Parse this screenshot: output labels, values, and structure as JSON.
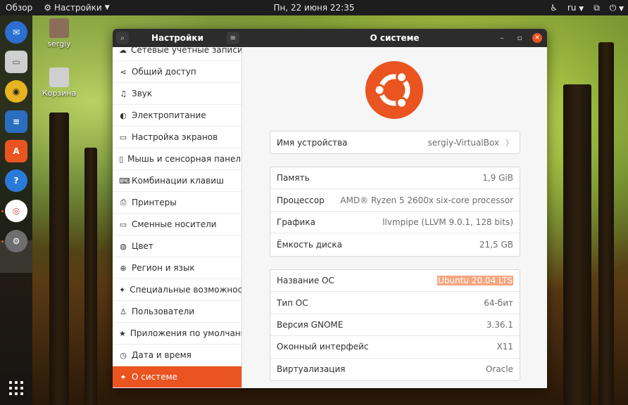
{
  "topbar": {
    "overview": "Обзор",
    "app_name": "Настройки",
    "clock": "Пн, 22 июня  22:35",
    "lang": "ru"
  },
  "desktop": {
    "home_label": "sergiy",
    "trash_label": "Корзина"
  },
  "window": {
    "sidebar_title": "Настройки",
    "main_title": "О системе"
  },
  "sidebar": {
    "items": [
      {
        "label": "Сетевые учётные записи",
        "icon": "cloud-icon"
      },
      {
        "label": "Общий доступ",
        "icon": "share-icon"
      },
      {
        "label": "Звук",
        "icon": "music-note-icon"
      },
      {
        "label": "Электропитание",
        "icon": "power-icon"
      },
      {
        "label": "Настройка экранов",
        "icon": "monitor-icon"
      },
      {
        "label": "Мышь и сенсорная панель",
        "icon": "mouse-icon"
      },
      {
        "label": "Комбинации клавиш",
        "icon": "keyboard-icon"
      },
      {
        "label": "Принтеры",
        "icon": "printer-icon"
      },
      {
        "label": "Сменные носители",
        "icon": "media-icon"
      },
      {
        "label": "Цвет",
        "icon": "color-icon"
      },
      {
        "label": "Регион и язык",
        "icon": "globe-icon"
      },
      {
        "label": "Специальные возможности",
        "icon": "accessibility-icon"
      },
      {
        "label": "Пользователи",
        "icon": "user-icon"
      },
      {
        "label": "Приложения по умолчанию",
        "icon": "star-icon"
      },
      {
        "label": "Дата и время",
        "icon": "clock-icon"
      },
      {
        "label": "О системе",
        "icon": "sparkle-icon",
        "active": true
      }
    ]
  },
  "about": {
    "device": {
      "label": "Имя устройства",
      "value": "sergiy-VirtualBox"
    },
    "hardware": [
      {
        "label": "Память",
        "value": "1,9 GiB"
      },
      {
        "label": "Процессор",
        "value": "AMD® Ryzen 5 2600x six-core processor"
      },
      {
        "label": "Графика",
        "value": "llvmpipe (LLVM 9.0.1, 128 bits)"
      },
      {
        "label": "Ёмкость диска",
        "value": "21,5 GB"
      }
    ],
    "software": [
      {
        "label": "Название ОС",
        "value": "Ubuntu 20.04 LTS",
        "highlight": true
      },
      {
        "label": "Тип ОС",
        "value": "64-бит"
      },
      {
        "label": "Версия GNOME",
        "value": "3.36.1"
      },
      {
        "label": "Оконный интерфейс",
        "value": "X11"
      },
      {
        "label": "Виртуализация",
        "value": "Oracle"
      }
    ]
  },
  "colors": {
    "accent": "#e95420",
    "topbar": "#1d1d1d"
  }
}
